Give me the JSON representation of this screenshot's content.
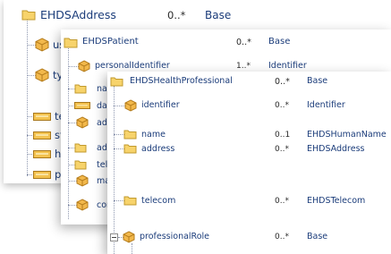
{
  "panel1": {
    "title": "EHDSAddress",
    "title_card": "0..*",
    "title_type": "Base",
    "rows": [
      {
        "label": "us"
      },
      {
        "label": "ty"
      },
      {
        "label": "te"
      },
      {
        "label": "st"
      },
      {
        "label": "ho"
      },
      {
        "label": "p"
      }
    ]
  },
  "panel2": {
    "title": "EHDSPatient",
    "title_card": "0..*",
    "title_type": "Base",
    "rows": [
      {
        "label": "personalIdentifier",
        "card": "1..*",
        "type": "Identifier"
      },
      {
        "label": "nam",
        "card": "",
        "type": ""
      },
      {
        "label": "dat",
        "card": "",
        "type": ""
      },
      {
        "label": "adm",
        "card": "",
        "type": ""
      },
      {
        "label": "add",
        "card": "",
        "type": ""
      },
      {
        "label": "tele",
        "card": "",
        "type": ""
      },
      {
        "label": "ma",
        "card": "",
        "type": ""
      },
      {
        "label": "cor",
        "card": "",
        "type": ""
      }
    ]
  },
  "panel3": {
    "title": "EHDSHealthProfessional",
    "title_card": "0..*",
    "title_type": "Base",
    "rows": [
      {
        "label": "identifier",
        "card": "0..*",
        "type": "Identifier"
      },
      {
        "label": "name",
        "card": "0..1",
        "type": "EHDSHumanName"
      },
      {
        "label": "address",
        "card": "0..*",
        "type": "EHDSAddress"
      },
      {
        "label": "telecom",
        "card": "0..*",
        "type": "EHDSTelecom"
      },
      {
        "label": "professionalRole",
        "card": "0..*",
        "type": "Base"
      }
    ]
  }
}
